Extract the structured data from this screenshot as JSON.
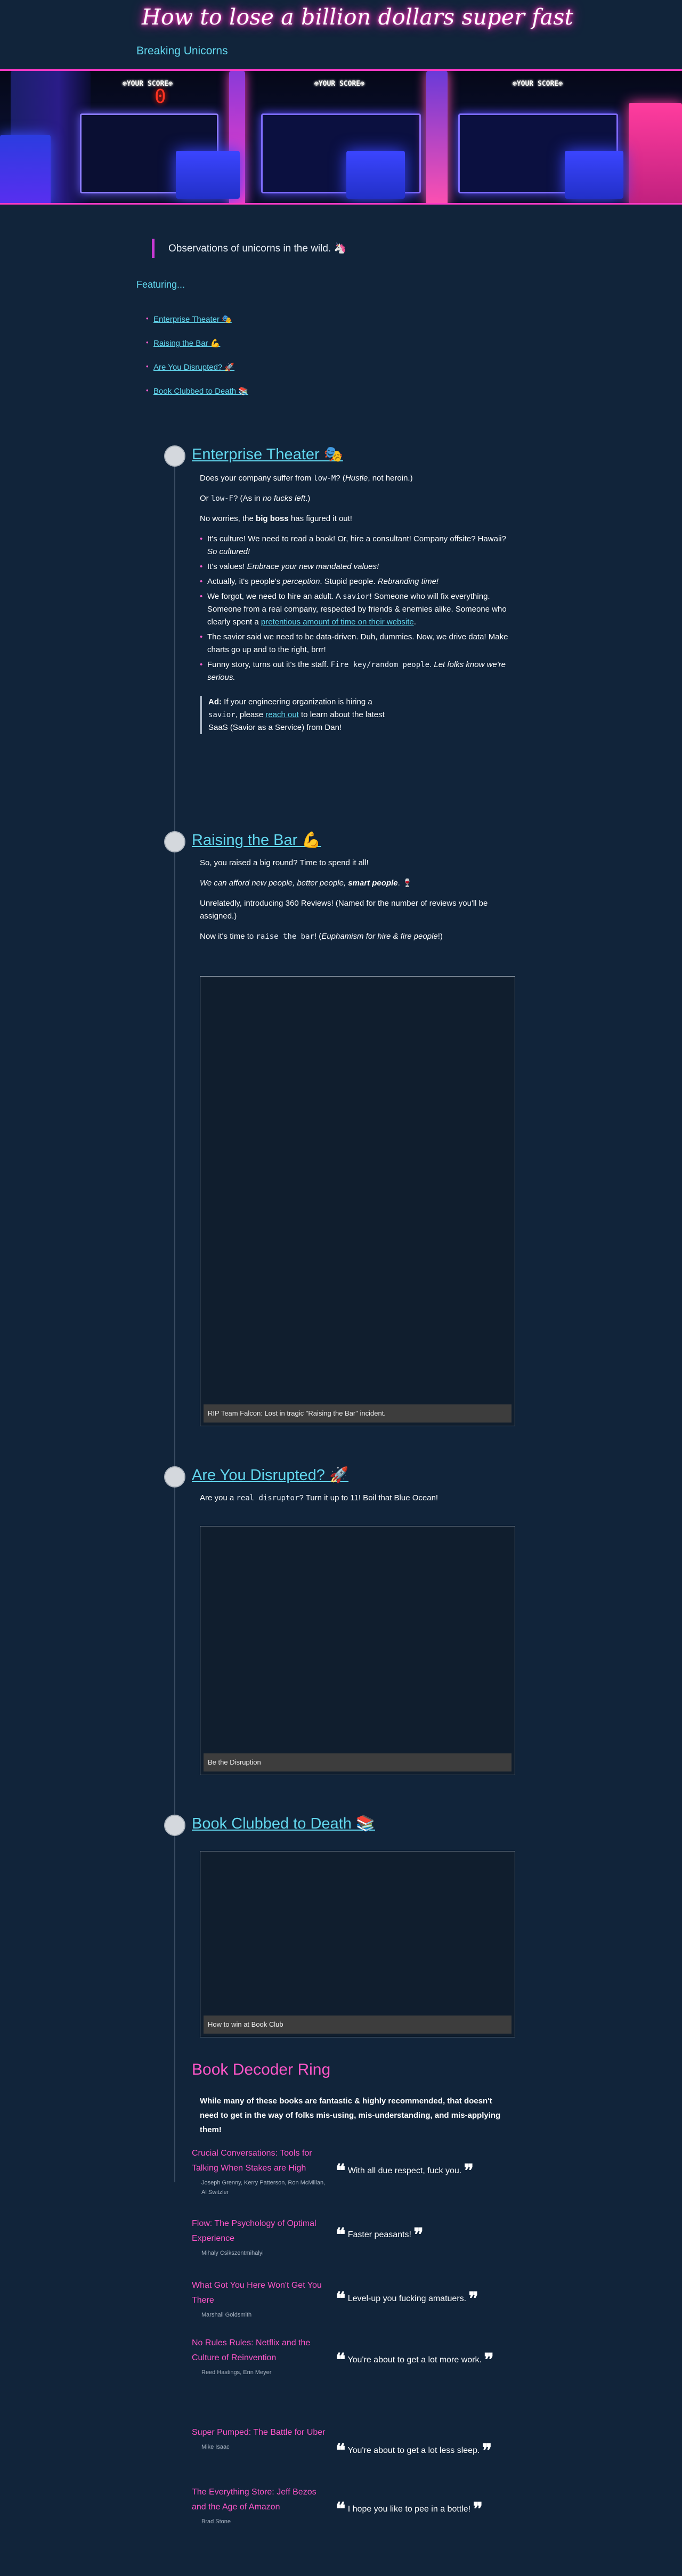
{
  "site": {
    "title": "How to lose a billion dollars super fast",
    "subtitle": "Breaking Unicorns"
  },
  "banner": {
    "score_label_1": "⊕YOUR SCORE⊕",
    "score_label_2": "⊕YOUR SCORE⊕",
    "score_label_3": "⊕YOUR SCORE⊕",
    "score_digit": "0"
  },
  "intro": "Observations of unicorns in the wild. 🦄",
  "featuring_label": "Featuring...",
  "toc": [
    {
      "label": "Enterprise Theater 🎭"
    },
    {
      "label": "Raising the Bar 💪"
    },
    {
      "label": "Are You Disrupted? 🚀"
    },
    {
      "label": "Book Clubbed to Death 📚"
    }
  ],
  "sections": {
    "enterprise": {
      "title": "Enterprise Theater 🎭",
      "p1_a": "Does your company suffer from ",
      "p1_code": "low-M",
      "p1_b": "? (",
      "p1_em": "Hustle",
      "p1_c": ", not heroin.)",
      "p2_a": "Or ",
      "p2_code": "low-F",
      "p2_b": "? (As in ",
      "p2_em": "no fucks left",
      "p2_c": ".)",
      "p3_a": "No worries, the ",
      "p3_strong": "big boss",
      "p3_b": " has figured it out!",
      "items": [
        {
          "a": "It's culture! We need to read a book! Or, hire a consultant! Company offsite? Hawaii? ",
          "em": "So cultured!"
        },
        {
          "a": "It's values! ",
          "em": "Embrace your new mandated values!"
        },
        {
          "a": "Actually, it's people's ",
          "em": "perception",
          "b": ". Stupid people. ",
          "em2": "Rebranding time!"
        },
        {
          "a": "We forgot, we need to hire an adult. A ",
          "code": "savior",
          "b": "! Someone who will fix everything. Someone from a real company, respected by friends & enemies alike. Someone who clearly spent a ",
          "link": "pretentious amount of time on their website",
          "c": "."
        },
        {
          "a": "The savior said we need to be data-driven. Duh, dummies. Now, we drive data! Make charts go up and to the right, brrr!"
        },
        {
          "a": "Funny story, turns out it's the staff. ",
          "code": "Fire key/random people",
          "b": ". ",
          "em": "Let folks know we're serious."
        }
      ],
      "ad_strong": "Ad:",
      "ad_a": " If your engineering organization is hiring a ",
      "ad_code": "savior",
      "ad_b": ", please ",
      "ad_link": "reach out",
      "ad_c": " to learn about the latest SaaS (Savior as a Service) from Dan!"
    },
    "raising": {
      "title": "Raising the Bar 💪",
      "p1": "So, you raised a big round? Time to spend it all!",
      "p2_em": "We can afford new people, better people, ",
      "p2_strong": "smart people",
      "p2_b": ". 🍷",
      "p3": "Unrelatedly, introducing 360 Reviews! (Named for the number of reviews you'll be assigned.)",
      "p4_a": "Now it's time to ",
      "p4_code": "raise the bar",
      "p4_b": "! (",
      "p4_em": "Euphamism for hire & fire people",
      "p4_c": "!)",
      "caption": "RIP Team Falcon: Lost in tragic \"Raising the Bar\" incident."
    },
    "disrupted": {
      "title": "Are You Disrupted? 🚀",
      "p1_a": "Are you a ",
      "p1_code": "real disruptor",
      "p1_b": "? Turn it up to 11! Boil that Blue Ocean!",
      "caption": "Be the Disruption"
    },
    "book": {
      "title": "Book Clubbed to Death 📚",
      "caption": "How to win at Book Club"
    }
  },
  "decoder": {
    "title": "Book Decoder Ring",
    "intro_a": "While many of these books are fantastic & highly recommended, that ",
    "intro_strong": "doesn't need to get in the way of folks mis-using, mis-understanding, and mis-applying them!",
    "books": [
      {
        "title": "Crucial Conversations: Tools for Talking When Stakes are High",
        "authors": "Joseph Grenny, Kerry Patterson, Ron McMillan, Al Switzler",
        "quote": "With all due respect, fuck you."
      },
      {
        "title": "Flow: The Psychology of Optimal Experience",
        "authors": "Mihaly Csikszentmihalyi",
        "quote": "Faster peasants!"
      },
      {
        "title": "What Got You Here Won't Get You There",
        "authors": "Marshall Goldsmith",
        "quote": "Level-up you fucking amatuers."
      },
      {
        "title": "No Rules Rules: Netflix and the Culture of Reinvention",
        "authors": "Reed Hastings, Erin Meyer",
        "quote": "You're about to get a lot more work."
      },
      {
        "title": "Super Pumped: The Battle for Uber",
        "authors": "Mike Isaac",
        "quote": "You're about to get a lot less sleep."
      },
      {
        "title": "The Everything Store: Jeff Bezos and the Age of Amazon",
        "authors": "Brad Stone",
        "quote": "I hope you like to pee in a bottle!"
      }
    ]
  },
  "colors": {
    "background": "#11243a",
    "accent_cyan": "#62d7ee",
    "accent_pink": "#ff56c8",
    "neon_border": "#ff39c6"
  }
}
